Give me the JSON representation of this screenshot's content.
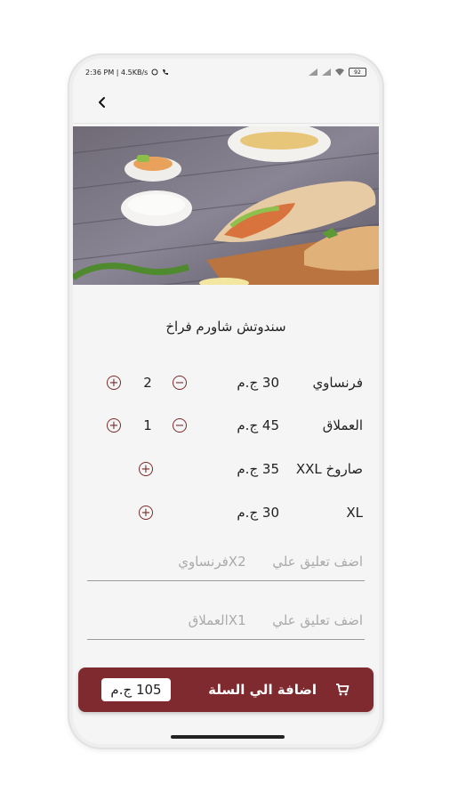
{
  "status_bar": {
    "time_info": "2:36 PM | 4.5KB/s",
    "battery": "92"
  },
  "product": {
    "title": "سندوتش شاورم فراخ"
  },
  "sizes": [
    {
      "name": "فرنساوي",
      "price": "30 ج.م",
      "qty": "2"
    },
    {
      "name": "العملاق",
      "price": "45 ج.م",
      "qty": "1"
    },
    {
      "name": "صاروخ XXL",
      "price": "35 ج.م"
    },
    {
      "name": "XL",
      "price": "30 ج.م"
    }
  ],
  "icons": {
    "minus": "−",
    "plus": "+"
  },
  "comments": [
    {
      "placeholder": "اضف تعليق علي",
      "item": "X2فرنساوي"
    },
    {
      "placeholder": "اضف تعليق علي",
      "item": "X1العملاق"
    }
  ],
  "cart": {
    "button_label": "اضافة الي السلة",
    "total": "105 ج.م"
  }
}
